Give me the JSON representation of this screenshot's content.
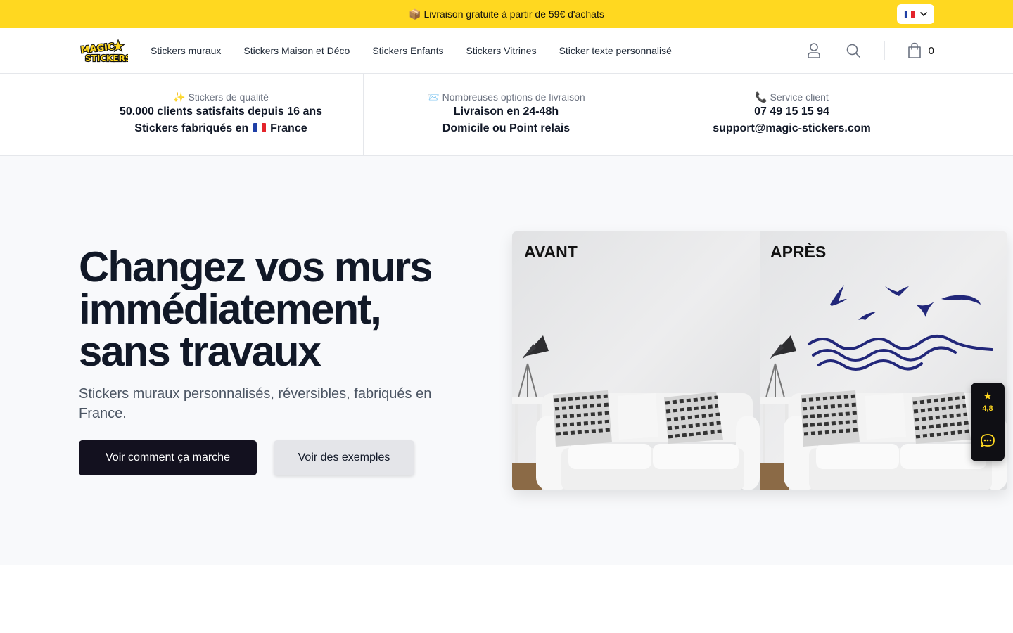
{
  "announcement": {
    "text": "📦 Livraison gratuite à partir de 59€ d'achats",
    "language_flag_icon": "france-flag-icon"
  },
  "header": {
    "logo_text": [
      "MAGIC",
      "STICKERS"
    ],
    "nav": [
      {
        "label": "Stickers muraux"
      },
      {
        "label": "Stickers Maison et Déco"
      },
      {
        "label": "Stickers Enfants"
      },
      {
        "label": "Stickers Vitrines"
      },
      {
        "label": "Sticker texte personnalisé"
      }
    ],
    "icons": [
      "account-icon",
      "search-icon",
      "shopping-bag-icon"
    ],
    "cart_count": "0"
  },
  "info": [
    {
      "kicker": "✨ Stickers de qualité",
      "line1": "50.000 clients satisfaits depuis 16 ans",
      "line2_before": "Stickers fabriqués en",
      "line2_after": "France"
    },
    {
      "kicker": "📨 Nombreuses options de livraison",
      "line1": "Livraison en 24-48h",
      "line2": "Domicile ou Point relais"
    },
    {
      "kicker": "📞 Service client",
      "line1": "07 49 15 15 94",
      "line2": "support@magic-stickers.com"
    }
  ],
  "hero": {
    "title_lines": [
      "Changez vos murs",
      "immédiatement,",
      "sans travaux"
    ],
    "subtitle": "Stickers muraux personnalisés, réversibles, fabriqués en France.",
    "primary_button": "Voir comment ça marche",
    "secondary_button": "Voir des exemples",
    "image": {
      "before_label": "AVANT",
      "after_label": "APRÈS"
    }
  },
  "widget": {
    "rating": "4,8",
    "icons": [
      "star-icon",
      "chat-icon"
    ]
  },
  "colors": {
    "brand_yellow": "#ffd820",
    "dark": "#13111f",
    "sticker_navy": "#22277a",
    "hero_bg": "#f8f9fb"
  }
}
